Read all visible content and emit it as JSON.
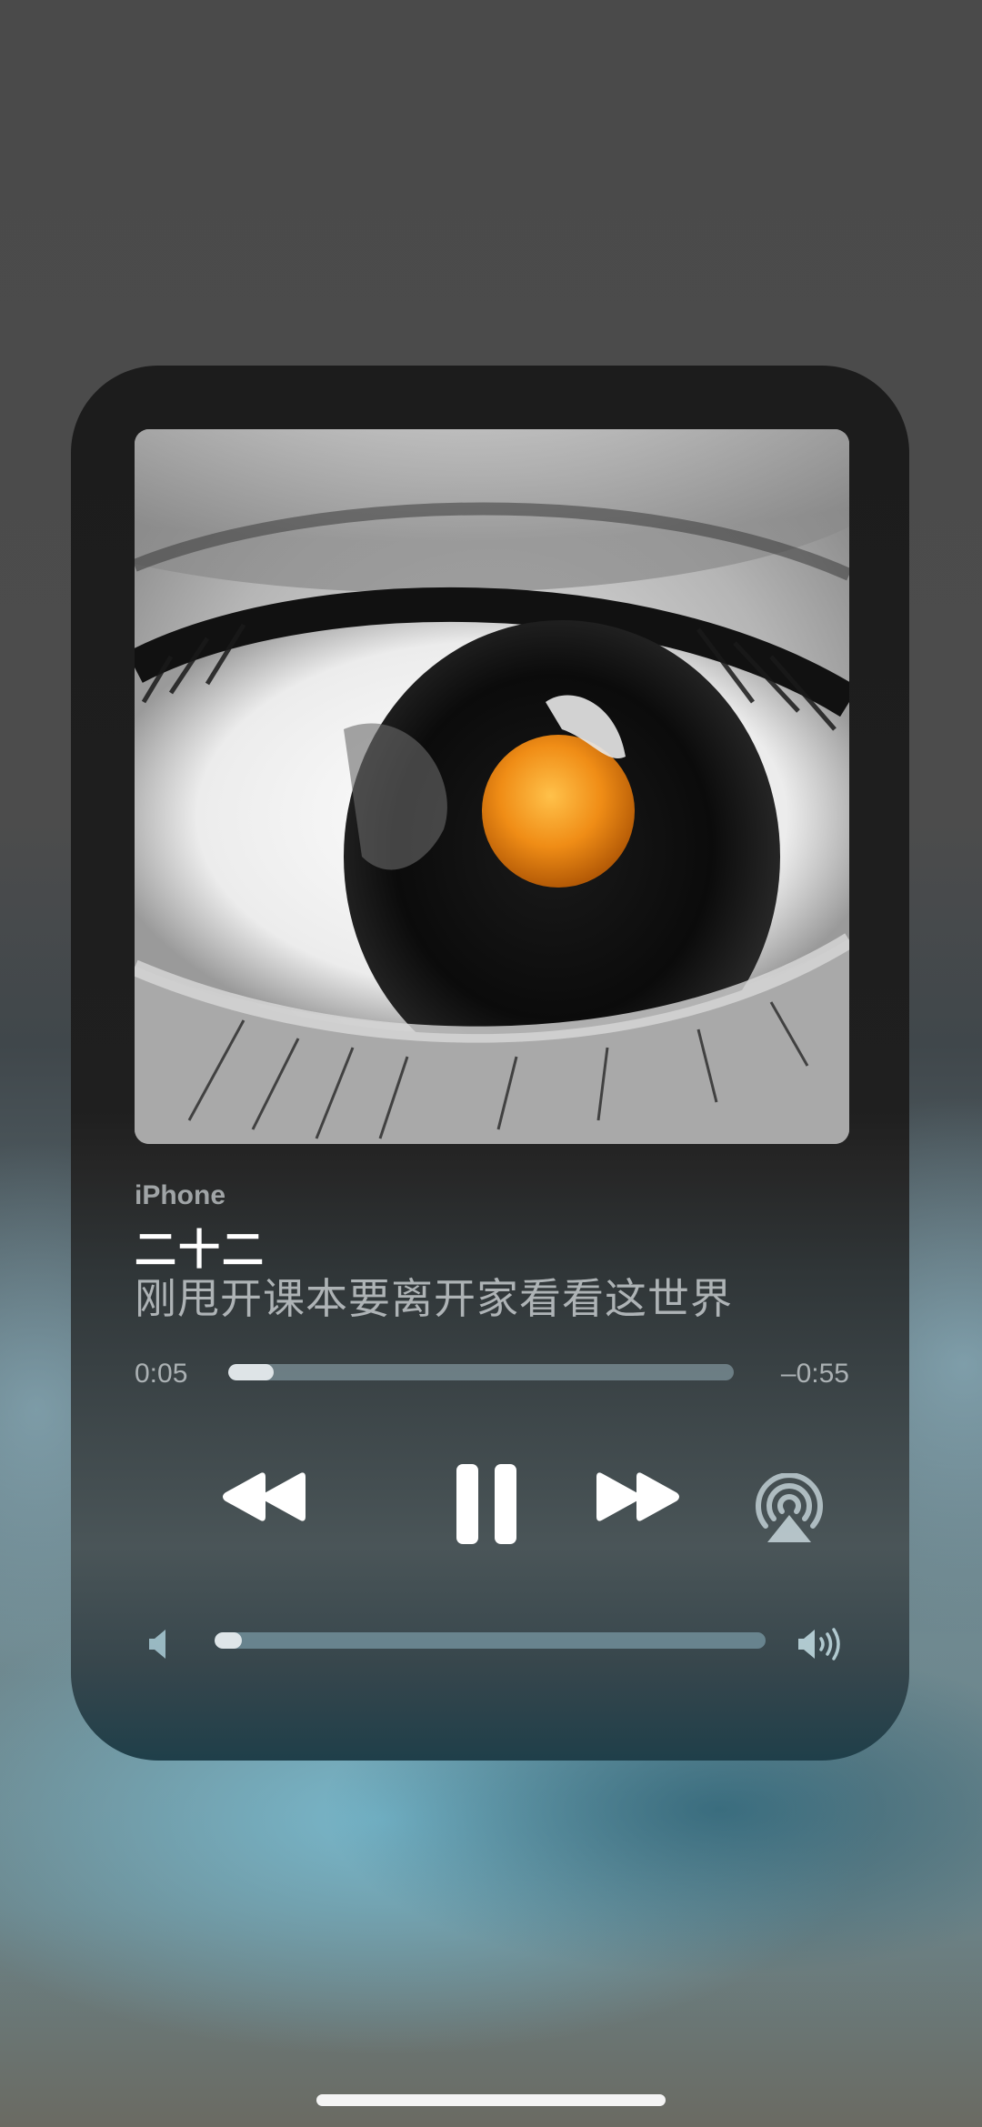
{
  "now_playing": {
    "source": "iPhone",
    "title": "二十二",
    "subtitle": "刚甩开课本要离开家看看这世界",
    "artwork": "eye-closeup-artwork"
  },
  "progress": {
    "elapsed": "0:05",
    "remaining": "–0:55",
    "fraction": 0.09
  },
  "controls": {
    "rewind_icon": "rewind-icon",
    "pause_icon": "pause-icon",
    "forward_icon": "fast-forward-icon",
    "airplay_icon": "airplay-audio-icon"
  },
  "volume": {
    "level": 0.05,
    "low_icon": "speaker-low-icon",
    "high_icon": "speaker-high-icon"
  },
  "colors": {
    "card_top": "#1c1c1c",
    "accent_teal": "#78b9cd",
    "iris": "#e88a18"
  }
}
